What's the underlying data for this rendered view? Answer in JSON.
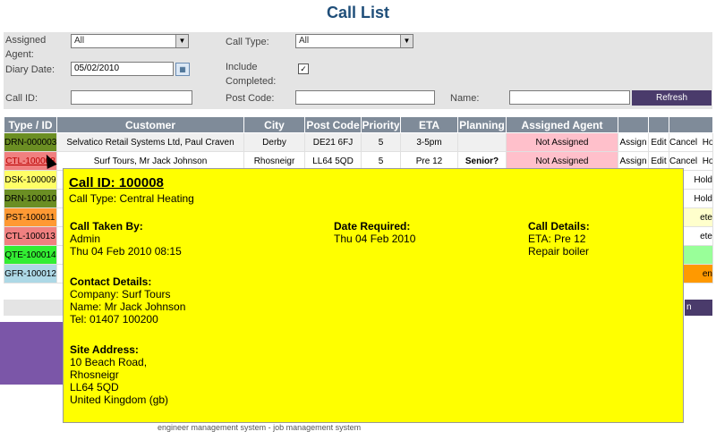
{
  "page": {
    "title": "Call List",
    "footer": "engineer management system - job management system"
  },
  "filters": {
    "assigned_agent_label": "Assigned Agent:",
    "assigned_agent_value": "All",
    "call_type_label": "Call Type:",
    "call_type_value": "All",
    "diary_date_label": "Diary Date:",
    "diary_date_value": "05/02/2010",
    "include_completed_label": "Include Completed:",
    "include_completed_checked": "✓",
    "call_id_label": "Call ID:",
    "call_id_value": "",
    "post_code_label": "Post Code:",
    "post_code_value": "",
    "name_label": "Name:",
    "name_value": "",
    "refresh_label": "Refresh"
  },
  "table": {
    "headers": [
      "Type / ID",
      "Customer",
      "City",
      "Post Code",
      "Priority",
      "ETA",
      "Planning",
      "Assigned Agent"
    ],
    "rows": [
      {
        "id": "DRN-000003",
        "id_color": "#6b8e23",
        "customer": "Selvatico Retail Systems Ltd, Paul Craven",
        "city": "Derby",
        "postcode": "DE21 6FJ",
        "priority": "5",
        "eta": "3-5pm",
        "planning": "",
        "agent": "Not Assigned",
        "assign": "Assign",
        "edit": "Edit",
        "cancel": "Cancel",
        "hold": "Hold"
      },
      {
        "id": "CTL-100008",
        "id_color": "#f08080",
        "customer": "Surf Tours, Mr Jack Johnson",
        "city": "Rhosneigr",
        "postcode": "LL64 5QD",
        "priority": "5",
        "eta": "Pre 12",
        "planning": "Senior?",
        "agent": "Not Assigned",
        "assign": "Assign",
        "edit": "Edit",
        "cancel": "Cancel",
        "hold": "Hold"
      },
      {
        "id": "DSK-100009",
        "id_color": "#ffff66",
        "tail": "Hold",
        "tail_color": "#ffffff"
      },
      {
        "id": "DRN-100010",
        "id_color": "#6b8e23",
        "tail": "Hold",
        "tail_color": "#ffffff"
      },
      {
        "id": "PST-100011",
        "id_color": "#ff9933",
        "tail": "ete",
        "tail_color": "#ffffcc"
      },
      {
        "id": "CTL-100013",
        "id_color": "#f08080",
        "tail": "ete",
        "tail_color": "#ffffff"
      },
      {
        "id": "QTE-100014",
        "id_color": "#33ee33",
        "tail": "",
        "tail_color": "#99ff99"
      },
      {
        "id": "GFR-100012",
        "id_color": "#add8e6",
        "tail": "en",
        "tail_color": "#ff9900"
      }
    ]
  },
  "popup": {
    "call_id": "Call ID: 100008",
    "call_type": "Call Type: Central Heating",
    "taken_by_heading": "Call Taken By:",
    "taken_by_name": "Admin",
    "taken_by_date": "Thu 04 Feb 2010 08:15",
    "date_required_heading": "Date Required:",
    "date_required_value": "Thu 04 Feb 2010",
    "call_details_heading": "Call Details:",
    "call_details_eta": "ETA: Pre 12",
    "call_details_desc": "Repair boiler",
    "contact_heading": "Contact Details:",
    "contact_company": "Company: Surf Tours",
    "contact_name": "Name: Mr Jack Johnson",
    "contact_tel": "Tel: 01407 100200",
    "site_heading": "Site Address:",
    "site_line1": "10 Beach Road,",
    "site_line2": "Rhosneigr",
    "site_line3": "LL64 5QD",
    "site_line4": "United Kingdom (gb)"
  }
}
